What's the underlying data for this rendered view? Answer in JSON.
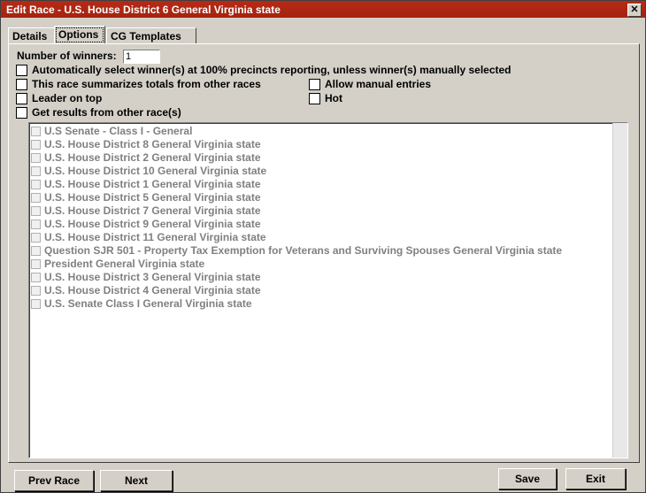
{
  "window": {
    "title": "Edit Race - U.S. House District 6 General Virginia state",
    "close_glyph": "✕"
  },
  "tabs": [
    {
      "label": "Details",
      "active": false
    },
    {
      "label": "Options",
      "active": true
    },
    {
      "label": "CG Templates",
      "active": false
    }
  ],
  "options": {
    "num_winners_label": "Number of winners:",
    "num_winners_value": "1",
    "auto_select_label": "Automatically select winner(s) at 100% precincts reporting, unless winner(s) manually selected",
    "summarize_label": "This race summarizes totals from other races",
    "allow_manual_label": "Allow manual entries",
    "leader_on_top_label": "Leader on top",
    "hot_label": "Hot",
    "get_results_label": "Get results from other race(s)"
  },
  "race_list": [
    "U.S Senate - Class I - General",
    "U.S. House District 8 General Virginia state",
    "U.S. House District 2 General Virginia state",
    "U.S. House District 10 General Virginia state",
    "U.S. House District 1 General Virginia state",
    "U.S. House District 5 General Virginia state",
    "U.S. House District 7 General Virginia state",
    "U.S. House District 9 General Virginia state",
    "U.S. House District 11 General Virginia state",
    "Question SJR 501 - Property Tax Exemption for Veterans and Surviving Spouses General Virginia state",
    "President General Virginia state",
    "U.S. House District 3 General Virginia state",
    "U.S. House District 4 General Virginia state",
    "U.S. Senate Class I General Virginia state"
  ],
  "buttons": {
    "prev_race": "Prev Race",
    "next": "Next",
    "save": "Save",
    "exit": "Exit"
  }
}
